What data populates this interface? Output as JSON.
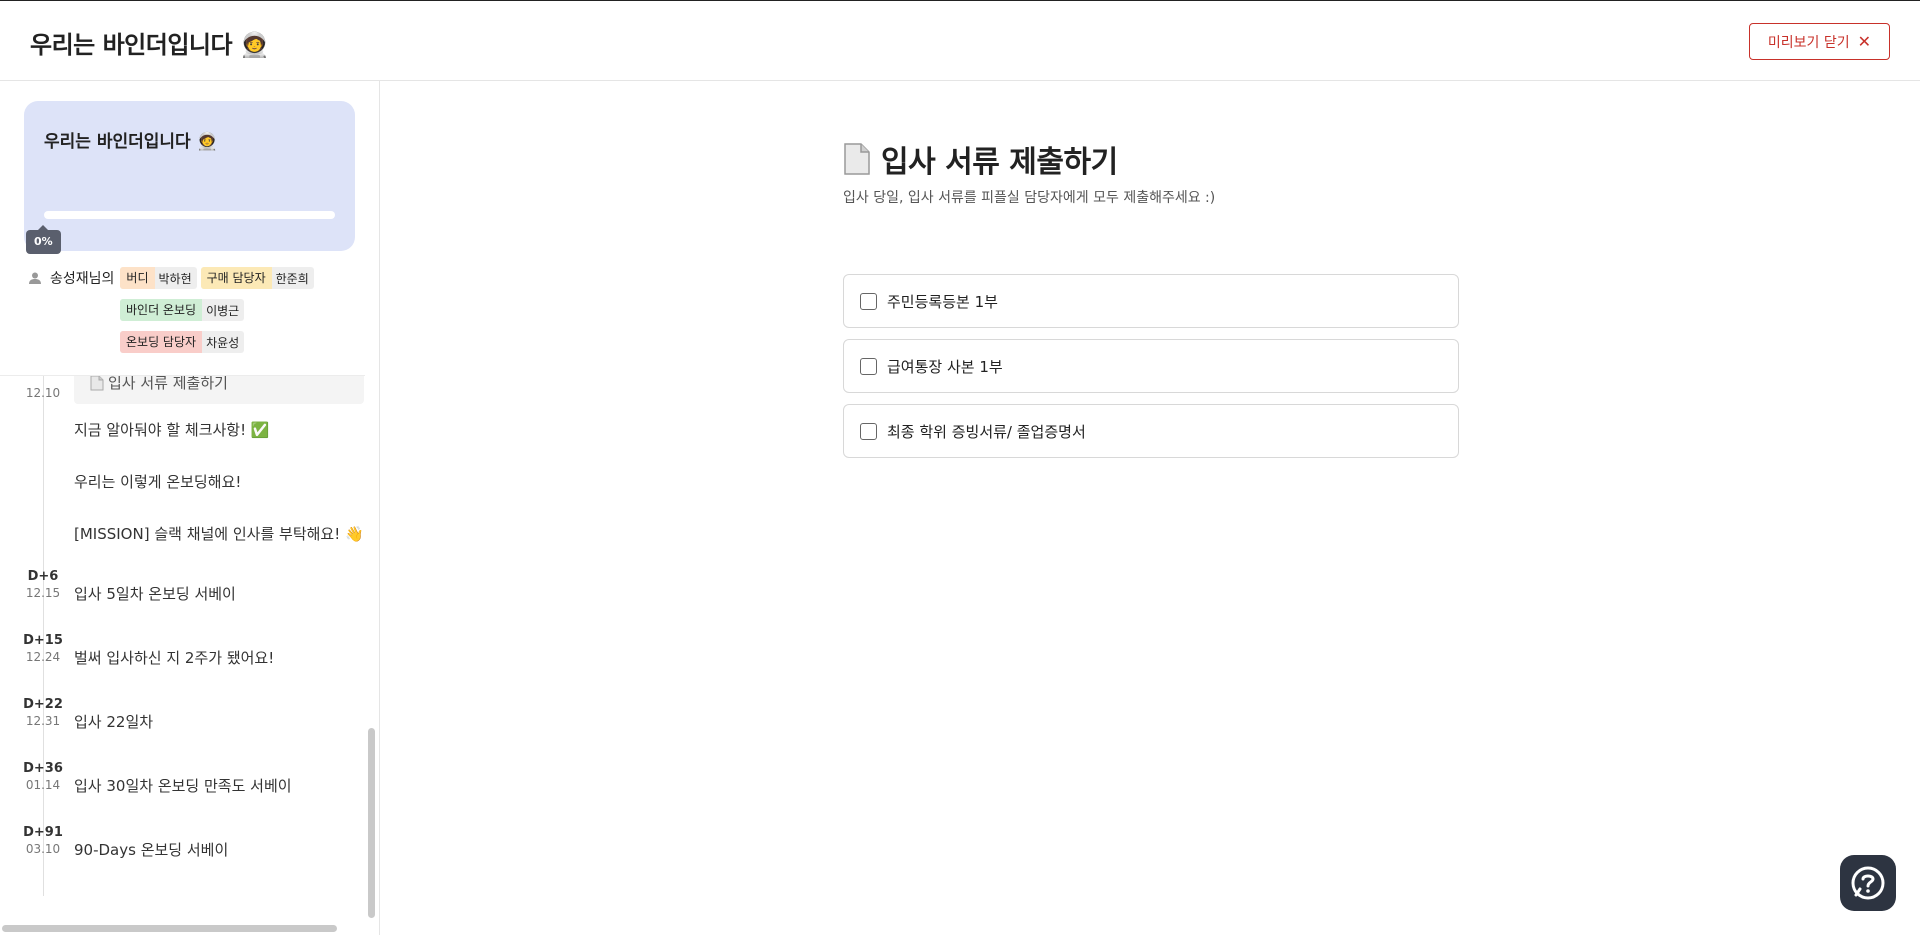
{
  "header": {
    "title": "우리는 바인더입니다 🧑‍🚀",
    "close_label": "미리보기 닫기"
  },
  "sidebar": {
    "card": {
      "title": "우리는 바인더입니다 🧑‍🚀",
      "progress_percent": 0,
      "progress_label": "0%"
    },
    "members": {
      "me": "송성재님의",
      "tags": [
        {
          "role": "버디",
          "name": "박하현"
        },
        {
          "role": "구매 담당자",
          "name": "한준희"
        },
        {
          "role": "바인더 온보딩",
          "name": "이병근"
        },
        {
          "role": "온보딩 담당자",
          "name": "차윤성"
        }
      ]
    },
    "timeline": {
      "active_date": "12.10",
      "active_item": "입사 서류 제출하기",
      "sub_items": [
        "지금 알아둬야 할 체크사항! ✅",
        "우리는 이렇게 온보딩해요!",
        "[MISSION] 슬랙 채널에 인사를 부탁해요! 👋"
      ],
      "days": [
        {
          "d": "D+6",
          "date": "12.15",
          "label": "입사 5일차 온보딩 서베이"
        },
        {
          "d": "D+15",
          "date": "12.24",
          "label": "벌써 입사하신 지 2주가 됐어요!"
        },
        {
          "d": "D+22",
          "date": "12.31",
          "label": "입사 22일차"
        },
        {
          "d": "D+36",
          "date": "01.14",
          "label": "입사 30일차 온보딩 만족도 서베이"
        },
        {
          "d": "D+91",
          "date": "03.10",
          "label": "90-Days 온보딩 서베이"
        }
      ]
    }
  },
  "main": {
    "title": "입사 서류 제출하기",
    "description": "입사 당일, 입사 서류를 피플실 담당자에게 모두 제출해주세요 :)",
    "checklist": [
      "주민등록등본 1부",
      "급여통장 사본 1부",
      "최종 학위 증빙서류/ 졸업증명서"
    ]
  },
  "colors": {
    "accent_red": "#c8312a",
    "card_bg": "#dde3f8",
    "help_bg": "#2d3441"
  }
}
